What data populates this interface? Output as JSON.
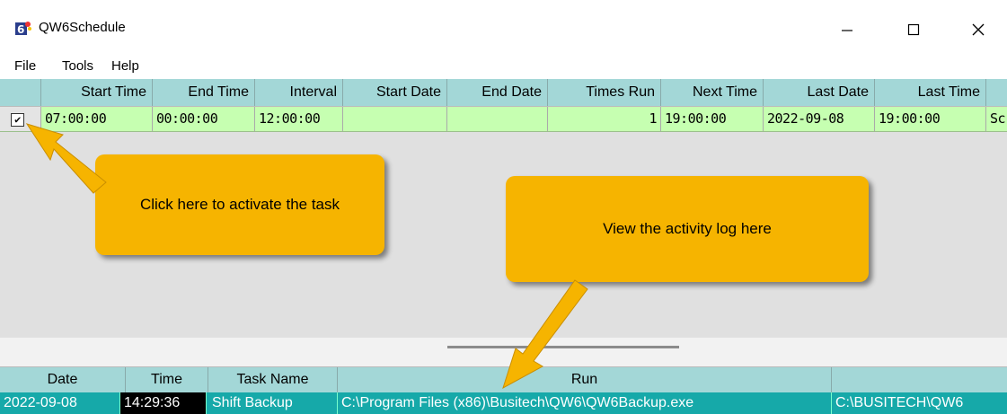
{
  "window": {
    "title": "QW6Schedule",
    "icon_label": "6"
  },
  "menu": [
    "File",
    "Tools",
    "Help"
  ],
  "schedule": {
    "columns": [
      "Start Time",
      "End Time",
      "Interval",
      "Start Date",
      "End Date",
      "Times Run",
      "Next Time",
      "Last Date",
      "Last Time"
    ],
    "row": {
      "checked": true,
      "start_time": "07:00:00",
      "end_time": "00:00:00",
      "interval": "12:00:00",
      "start_date": "",
      "end_date": "",
      "times_run": "1",
      "next_time": "19:00:00",
      "last_date": "2022-09-08",
      "last_time": "19:00:00",
      "overflow": "Sc"
    }
  },
  "log": {
    "columns": [
      "Date",
      "Time",
      "Task Name",
      "Run",
      ""
    ],
    "row": {
      "date": "2022-09-08",
      "time": "14:29:36",
      "task_name": "Shift Backup",
      "run": "C:\\Program Files (x86)\\Busitech\\QW6\\QW6Backup.exe",
      "extra": "C:\\BUSITECH\\QW6"
    }
  },
  "callouts": {
    "activate": "Click here to activate the task",
    "log": "View the activity log here"
  },
  "colors": {
    "header": "#a3d7d7",
    "active_row": "#c6ffb1",
    "log_row": "#16a9a9",
    "callout": "#f6b400"
  }
}
